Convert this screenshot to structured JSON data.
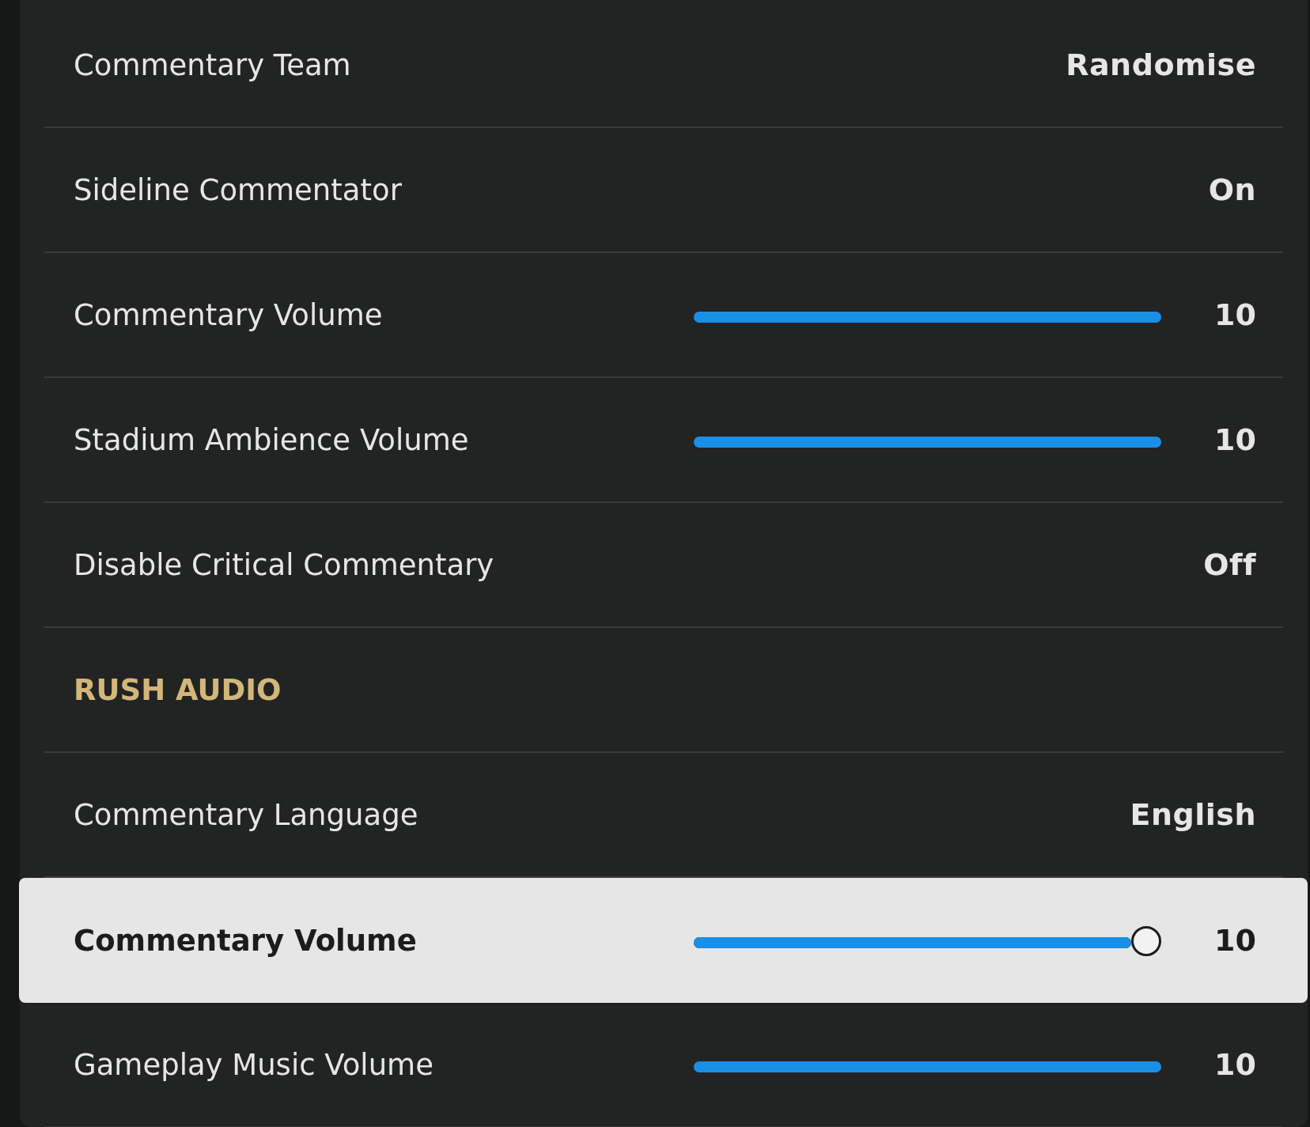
{
  "rows": [
    {
      "kind": "value",
      "label": "Commentary Team",
      "value": "Randomise",
      "selected": false
    },
    {
      "kind": "value",
      "label": "Sideline Commentator",
      "value": "On",
      "selected": false
    },
    {
      "kind": "slider",
      "label": "Commentary Volume",
      "level": 1,
      "value": "10",
      "selected": false
    },
    {
      "kind": "slider",
      "label": "Stadium Ambience Volume",
      "level": 1,
      "value": "10",
      "selected": false
    },
    {
      "kind": "value",
      "label": "Disable Critical Commentary",
      "value": "Off",
      "selected": false
    },
    {
      "kind": "header",
      "label": "RUSH AUDIO"
    },
    {
      "kind": "value",
      "label": "Commentary Language",
      "value": "English",
      "selected": false
    },
    {
      "kind": "slider",
      "label": "Commentary Volume",
      "level": 1,
      "value": "10",
      "selected": true
    },
    {
      "kind": "slider",
      "label": "Gameplay Music Volume",
      "level": 1,
      "value": "10",
      "selected": false
    }
  ]
}
